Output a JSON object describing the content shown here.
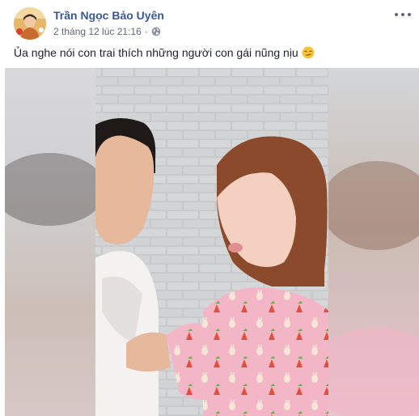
{
  "post": {
    "author_name": "Trần Ngọc Bảo Uyên",
    "timestamp": "2 tháng 12 lúc 21:16",
    "separator": "·",
    "privacy_icon": "globe-icon",
    "more_icon": "more-options-icon",
    "message": "Ủa nghe nói con trai thích những người con gái nũng nịu",
    "emoji_icon": "smirk-emoji-icon"
  },
  "colors": {
    "author_link": "#385898",
    "meta_text": "#616770",
    "body_text": "#1d2129"
  }
}
